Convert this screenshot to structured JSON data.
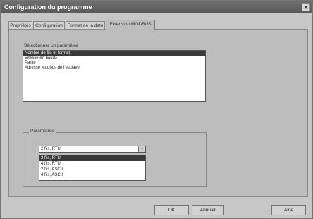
{
  "window": {
    "title": "Configuration du programme",
    "close_glyph": "x"
  },
  "tabs": [
    {
      "label": "Propriétés"
    },
    {
      "label": "Configuration"
    },
    {
      "label": "Format de la date"
    },
    {
      "label": "Extension MODBUS",
      "active": true
    }
  ],
  "select_label": "Sélectionner un paramètre :",
  "parameters_list": [
    {
      "label": "Nombre de fils et format",
      "selected": true
    },
    {
      "label": "Vitesse en bauds"
    },
    {
      "label": "Parité"
    },
    {
      "label": "Adresse Modbus de l'esclave"
    }
  ],
  "group": {
    "label": "Paramètres",
    "combo_value": "2 fils, RTU",
    "combo_arrow_glyph": "▾",
    "options": [
      {
        "label": "2 fils, RTU",
        "selected": true
      },
      {
        "label": "4 fils, RTU"
      },
      {
        "label": "2 fils, ASCII"
      },
      {
        "label": "4 fils, ASCII"
      }
    ]
  },
  "buttons": {
    "ok": "OK",
    "cancel": "Annuler",
    "help": "Aide"
  },
  "icons": {
    "close": "close-icon",
    "dropdown_arrow": "chevron-down-icon"
  },
  "colors": {
    "titlebar": "#5f5f5f",
    "selection": "#3a3a3a",
    "window_bg": "#c7c7c7"
  }
}
